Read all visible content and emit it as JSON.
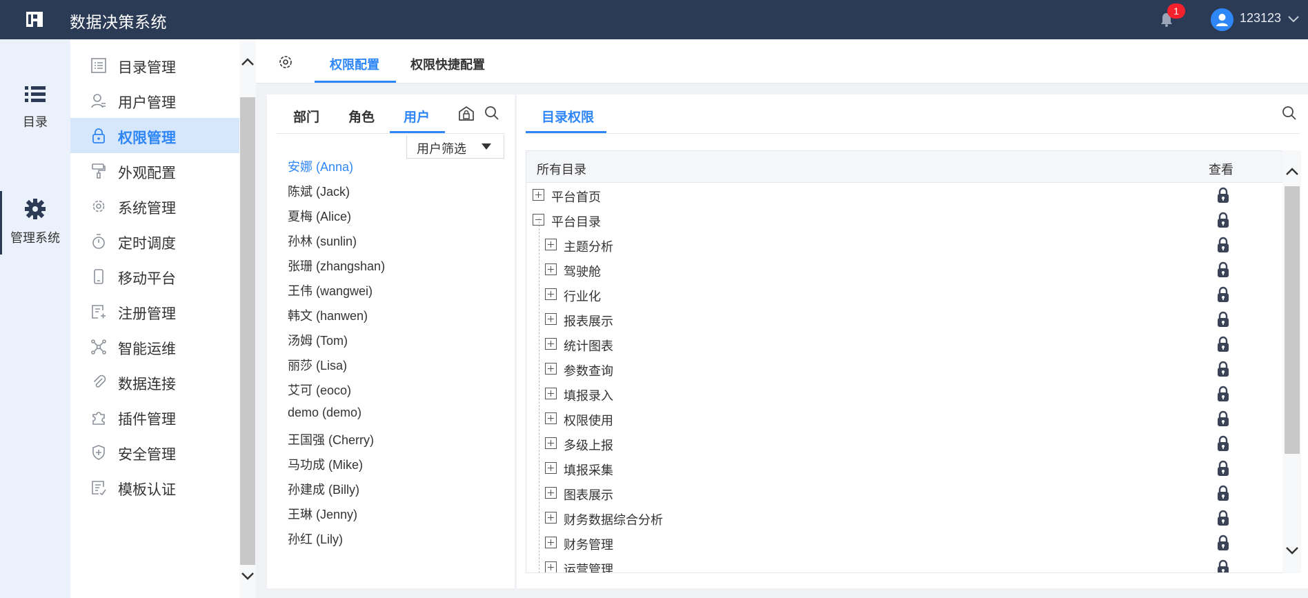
{
  "header": {
    "app_title": "数据决策系统",
    "notification_count": "1",
    "username": "123123"
  },
  "rail": {
    "items": [
      {
        "label": "目录",
        "icon": "list-icon"
      },
      {
        "label": "管理系统",
        "icon": "gear-icon"
      }
    ]
  },
  "menu": {
    "items": [
      {
        "label": "目录管理",
        "icon": "catalog-icon"
      },
      {
        "label": "用户管理",
        "icon": "user-icon"
      },
      {
        "label": "权限管理",
        "icon": "lock-icon",
        "active": true
      },
      {
        "label": "外观配置",
        "icon": "paint-roller-icon"
      },
      {
        "label": "系统管理",
        "icon": "gear-icon"
      },
      {
        "label": "定时调度",
        "icon": "timer-icon"
      },
      {
        "label": "移动平台",
        "icon": "mobile-icon"
      },
      {
        "label": "注册管理",
        "icon": "register-icon"
      },
      {
        "label": "智能运维",
        "icon": "network-icon"
      },
      {
        "label": "数据连接",
        "icon": "paperclip-icon"
      },
      {
        "label": "插件管理",
        "icon": "puzzle-icon"
      },
      {
        "label": "安全管理",
        "icon": "shield-icon"
      },
      {
        "label": "模板认证",
        "icon": "template-icon"
      }
    ]
  },
  "tabs": {
    "items": [
      {
        "label": "权限配置",
        "active": true
      },
      {
        "label": "权限快捷配置"
      }
    ]
  },
  "left_panel": {
    "subtabs": [
      {
        "label": "部门"
      },
      {
        "label": "角色"
      },
      {
        "label": "用户",
        "active": true
      }
    ],
    "filter_label": "用户筛选",
    "users": [
      "安娜 (Anna)",
      "陈斌 (Jack)",
      "夏梅 (Alice)",
      "孙林 (sunlin)",
      "张珊 (zhangshan)",
      "王伟 (wangwei)",
      "韩文 (hanwen)",
      "汤姆 (Tom)",
      "丽莎 (Lisa)",
      "艾可 (eoco)",
      "demo (demo)",
      "王国强 (Cherry)",
      "马功成 (Mike)",
      "孙建成 (Billy)",
      "王琳 (Jenny)",
      "孙红 (Lily)"
    ],
    "selected_user_index": 0
  },
  "right_panel": {
    "tab_label": "目录权限",
    "columns": [
      "所有目录",
      "查看"
    ],
    "tree": [
      {
        "label": "平台首页",
        "level": 0,
        "expanded": false
      },
      {
        "label": "平台目录",
        "level": 0,
        "expanded": true
      },
      {
        "label": "主题分析",
        "level": 1,
        "expanded": false
      },
      {
        "label": "驾驶舱",
        "level": 1,
        "expanded": false
      },
      {
        "label": "行业化",
        "level": 1,
        "expanded": false
      },
      {
        "label": "报表展示",
        "level": 1,
        "expanded": false
      },
      {
        "label": "统计图表",
        "level": 1,
        "expanded": false
      },
      {
        "label": "参数查询",
        "level": 1,
        "expanded": false
      },
      {
        "label": "填报录入",
        "level": 1,
        "expanded": false
      },
      {
        "label": "权限使用",
        "level": 1,
        "expanded": false
      },
      {
        "label": "多级上报",
        "level": 1,
        "expanded": false
      },
      {
        "label": "填报采集",
        "level": 1,
        "expanded": false
      },
      {
        "label": "图表展示",
        "level": 1,
        "expanded": false
      },
      {
        "label": "财务数据综合分析",
        "level": 1,
        "expanded": false
      },
      {
        "label": "财务管理",
        "level": 1,
        "expanded": false
      },
      {
        "label": "运营管理",
        "level": 1,
        "expanded": false
      }
    ]
  },
  "colors": {
    "header_bg": "#2b3a55",
    "accent": "#2f86f6",
    "active_menu_bg": "#d6e6fb",
    "rail_bg": "#eaf1fb",
    "badge": "#f5222d"
  }
}
